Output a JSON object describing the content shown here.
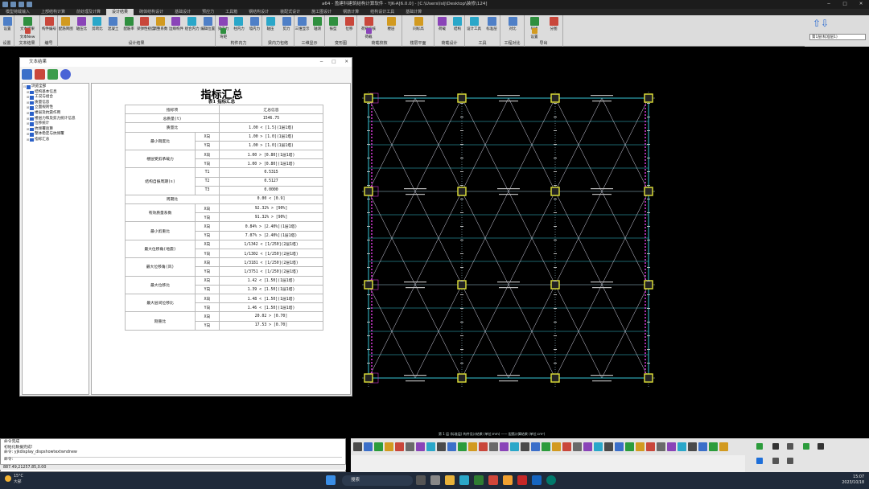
{
  "titlebar": {
    "title": "a64 - 盈建科建筑结构计算软件 - YJK-A[6.0.0] - [C:\\Users\\lslj\\Desktop\\装修\\124]"
  },
  "tabs": [
    "模型荷载输入",
    "上部结构计算",
    "前处理及计算",
    "设计结果",
    "砌体结构设计",
    "基础设计",
    "预应力",
    "工具箱",
    "钢结构设计",
    "装配式设计",
    "施工图设计",
    "钢筋计算",
    "结构设计工具",
    "基础计算"
  ],
  "ribbon": {
    "groups": [
      {
        "label": "设置",
        "buttons": [
          "设置"
        ]
      },
      {
        "label": "文本结果",
        "buttons": [
          "文本结果",
          "文本New"
        ]
      },
      {
        "label": "编号",
        "buttons": [
          "构件编号"
        ]
      },
      {
        "label": "设计结果",
        "buttons": [
          "配筋简图",
          "轴压比",
          "剪跨比",
          "混凝土",
          "配筋率",
          "梁弹性挠度",
          "调整系数",
          "边缘构件",
          "组合内力",
          "编辑位置"
        ]
      },
      {
        "label": "构件内力",
        "buttons": [
          "梁内力",
          "柱内力",
          "墙内力",
          "弯矩"
        ]
      },
      {
        "label": "梁内力包络",
        "buttons": [
          "轴压",
          "剪力"
        ]
      },
      {
        "label": "三维显示",
        "buttons": [
          "三维显示",
          "轴测"
        ]
      },
      {
        "label": "变形图",
        "buttons": [
          "振型",
          "位移"
        ]
      },
      {
        "label": "荷载校核",
        "buttons": [
          "荷载校核",
          "楼层",
          "荷载"
        ]
      },
      {
        "label": "楼层平面",
        "buttons": [
          "同标高"
        ]
      },
      {
        "label": "荷载设计",
        "buttons": [
          "荷载",
          "结构"
        ]
      },
      {
        "label": "工具",
        "buttons": [
          "设计工具",
          "标准层"
        ]
      },
      {
        "label": "工程对比",
        "buttons": [
          "对比"
        ]
      },
      {
        "label": "导出",
        "buttons": [
          "导出",
          "分图",
          "设置"
        ]
      }
    ],
    "floor_select": "第1层(标准层1)"
  },
  "dialog": {
    "title": "文本结果",
    "tree": [
      "浏览全部",
      "结构基本信息",
      "工况与组合",
      "质量信息",
      "立面规则性",
      "楼层及抗震作用",
      "楼层力和及剪力统计信息",
      "位移统计",
      "抗倾覆验算",
      "整体稳定与抗倾覆",
      "指标汇总"
    ],
    "report_title": "指标汇总",
    "report_subtitle": "表1  指标汇总",
    "header": {
      "item": "指标项",
      "value": "汇总信息"
    },
    "rows": [
      {
        "item": "总质量(t)",
        "dir": "",
        "value": "1546.75"
      },
      {
        "item": "质量比",
        "dir": "",
        "value": "1.00 < [1.5](1层1塔)"
      },
      {
        "item": "最小刚度比",
        "dir": "X向",
        "value": "1.00 > [1.0](1层1塔)"
      },
      {
        "item": "",
        "dir": "Y向",
        "value": "1.00 > [1.0](1层1塔)"
      },
      {
        "item": "楼层受剪承载力",
        "dir": "X向",
        "value": "1.00 > [0.80](1层1塔)"
      },
      {
        "item": "",
        "dir": "Y向",
        "value": "1.00 > [0.80](1层1塔)"
      },
      {
        "item": "结构自振周期(s)",
        "dir": "T1",
        "value": "0.5315"
      },
      {
        "item": "",
        "dir": "T2",
        "value": "0.5127"
      },
      {
        "item": "",
        "dir": "T3",
        "value": "0.0000"
      },
      {
        "item": "周期比",
        "dir": "",
        "value": "0.00 < [0.9]"
      },
      {
        "item": "有效质量系数",
        "dir": "X向",
        "value": "92.32% > [90%]"
      },
      {
        "item": "",
        "dir": "Y向",
        "value": "91.32% > [90%]"
      },
      {
        "item": "最小剪重比",
        "dir": "X向",
        "value": "0.84% > [2.40%](1层1塔)"
      },
      {
        "item": "",
        "dir": "Y向",
        "value": "7.07% > [2.40%](1层1塔)"
      },
      {
        "item": "最大位移角(地震)",
        "dir": "X向",
        "value": "1/1342 < [1/250](2层1塔)"
      },
      {
        "item": "",
        "dir": "Y向",
        "value": "1/1302 < [1/250](2层1塔)"
      },
      {
        "item": "最大位移角(风)",
        "dir": "X向",
        "value": "1/3181 < [1/250](2层1塔)"
      },
      {
        "item": "",
        "dir": "Y向",
        "value": "1/3751 < [1/250](2层1塔)"
      },
      {
        "item": "最大位移比",
        "dir": "X向",
        "value": "1.42 < [1.50](1层1塔)"
      },
      {
        "item": "",
        "dir": "Y向",
        "value": "1.39 < [1.50](1层1塔)"
      },
      {
        "item": "最大层间位移比",
        "dir": "X向",
        "value": "1.48 < [1.50](1层1塔)"
      },
      {
        "item": "",
        "dir": "Y向",
        "value": "1.46 < [1.50](1层1塔)"
      },
      {
        "item": "刚重比",
        "dir": "X向",
        "value": "20.02 > [0.70]"
      },
      {
        "item": "",
        "dir": "Y向",
        "value": "17.53 > [0.70]"
      }
    ]
  },
  "canvas": {
    "caption": "第 1 层 (标准层) 构件设计结果 (单位:mm) —— 配筋计算结果 (单位:cm²)"
  },
  "command": {
    "lines": [
      "命令完成",
      "初始化数据完成!",
      "命令: yjkdisplay_dispshowtextwndnew"
    ],
    "prompt": "命令:",
    "coords": "887.49,21257.85,0.00"
  },
  "taskbar": {
    "weather_temp": "15°C",
    "weather_desc": "大部",
    "search": "搜索",
    "time": "15:07",
    "date": "2023/10/18"
  },
  "colors": {
    "model_grid": "#9fc9d8",
    "beam": "#39c6d6",
    "column": "#e3e43a",
    "annot": "#cf38cf"
  }
}
